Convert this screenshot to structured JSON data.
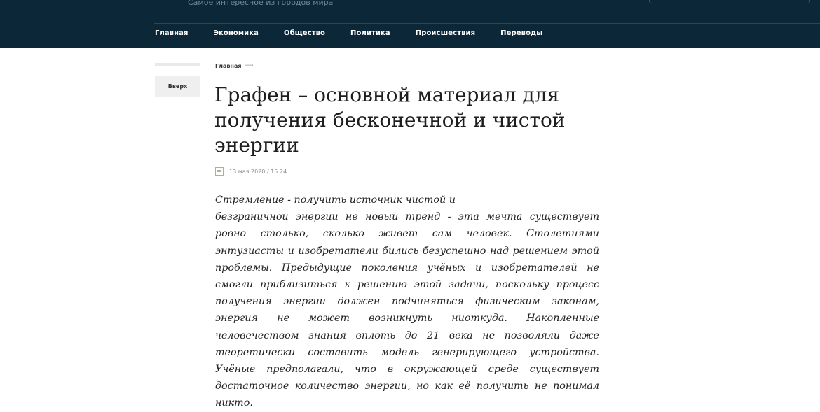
{
  "site": {
    "tagline": "Самое интересное из городов мира"
  },
  "nav": {
    "items": [
      "Главная",
      "Экономика",
      "Общество",
      "Политика",
      "Происшествия",
      "Переводы"
    ]
  },
  "sidebar": {
    "up_label": "Вверх"
  },
  "breadcrumb": {
    "home": "Главная",
    "arrow": "⟶"
  },
  "article": {
    "title": "Графен – основной материал для получения бесконечной и чистой энергии",
    "date": "13 мая 2020 / 15:24",
    "lead_line1": "Стремление - получить источник чистой и",
    "lead_body": "безграничной энергии не новый тренд - эта мечта существует ровно столько, сколько живет сам человек. Столетиями энтузиасты и изобретатели бились безуспешно над решением этой проблемы. Предыдущие поколения учёных и изобретателей не смогли приблизиться к решению этой задачи, поскольку процесс получения энергии должен подчиняться физическим законам, энергия не может возникнуть ниоткуда. Накопленные человечеством знания вплоть до 21 века не позволяли даже теоретически составить модель генерирующего устройства. Учёные предполагали, что в окружающей среде существует достаточное количество энергии, но как её получить не понимал никто."
  }
}
